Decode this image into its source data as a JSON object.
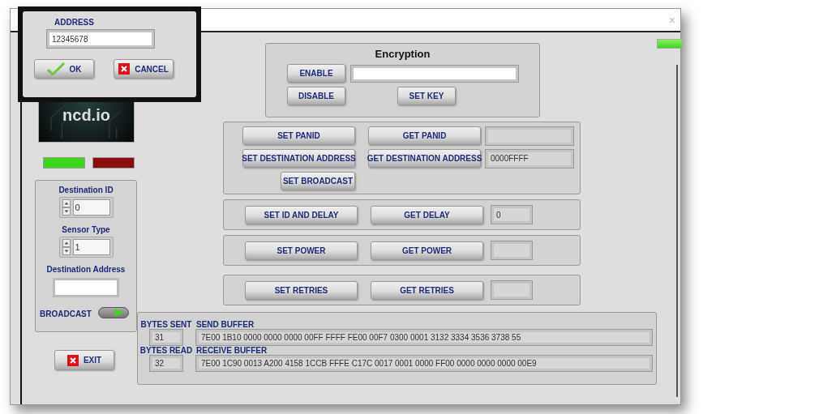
{
  "window": {
    "close": "×",
    "status_led": {
      "on": true
    }
  },
  "dialog": {
    "label": "ADDRESS",
    "value": "12345678",
    "buttons": [
      {
        "kind": "ok",
        "label": "OK"
      },
      {
        "kind": "cancel",
        "label": "CANCEL"
      }
    ]
  },
  "logo": {
    "text": "ncd.io"
  },
  "leds": [
    {
      "color": "#3cd61c"
    },
    {
      "color": "#8a0c0c"
    }
  ],
  "sidebar": {
    "fields": [
      {
        "kind": "spin",
        "label": "Destination ID",
        "value": "0"
      },
      {
        "kind": "spin",
        "label": "Sensor Type",
        "value": "1"
      },
      {
        "kind": "text",
        "label": "Destination Address"
      }
    ],
    "broadcast": {
      "label": "BROADCAST",
      "on": true
    },
    "exit": "EXIT"
  },
  "encryption": {
    "title": "Encryption",
    "enable": "ENABLE",
    "disable": "DISABLE",
    "set_key": "SET KEY"
  },
  "panid_panel": {
    "set_panid": "SET PANID",
    "get_panid": "GET PANID",
    "set_dest": "SET DESTINATION ADDRESS",
    "get_dest": "GET DESTINATION ADDRESS",
    "dest": "0000FFFF",
    "set_broadcast": "SET BROADCAST"
  },
  "rows": [
    {
      "set": "SET ID AND DELAY",
      "get": "GET DELAY",
      "value": "0"
    },
    {
      "set": "SET POWER",
      "get": "GET POWER"
    },
    {
      "set": "SET RETRIES",
      "get": "GET RETRIES"
    }
  ],
  "buffers": [
    {
      "count_label": "BYTES SENT",
      "count": "31",
      "label": "SEND BUFFER",
      "value": "7E00 1B10 0000 0000 0000 00FF FFFF FE00 00F7 0300 0001 3132 3334 3536 3738 55"
    },
    {
      "count_label": "BYTES READ",
      "count": "32",
      "label": "RECEIVE BUFFER",
      "value": "7E00 1C90 0013 A200 4158 1CCB FFFE C17C 0017 0001 0000 FF00 0000 0000 0000 00E9"
    }
  ]
}
